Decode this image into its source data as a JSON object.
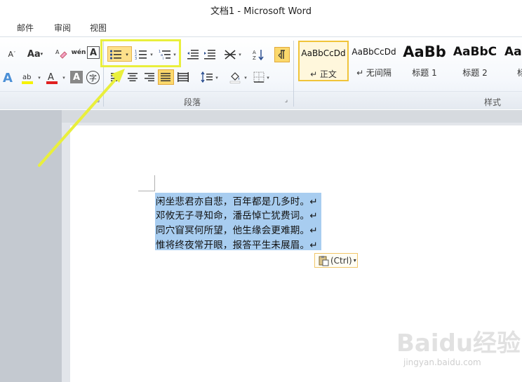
{
  "window": {
    "title": "文档1  -  Microsoft Word"
  },
  "menu": {
    "tabs": [
      "邮件",
      "审阅",
      "视图"
    ]
  },
  "ribbon": {
    "font_size_label": "A",
    "change_case_label": "Aa",
    "phonetic_label": "wén",
    "border_char_label": "A",
    "char_shading_label": "A",
    "enclose_char_label": "字",
    "paragraph_group_label": "段落",
    "styles_group_label": "样式",
    "accent_color": "#e9ef3c",
    "styles": [
      {
        "sample": "AaBbCcDd",
        "name": "↵ 正文"
      },
      {
        "sample": "AaBbCcDd",
        "name": "↵ 无间隔"
      },
      {
        "sample": "AaBb",
        "name": "标题 1"
      },
      {
        "sample": "AaBbC",
        "name": "标题 2"
      },
      {
        "sample": "Aa",
        "name": "标"
      }
    ]
  },
  "document": {
    "lines": [
      "闲坐悲君亦自悲，百年都是几多时。↵",
      "邓攸无子寻知命，潘岳悼亡犹费词。↵",
      "同穴窅冥何所望，他生缘会更难期。↵",
      "惟将终夜常开眼，报答平生未展眉。↵"
    ],
    "paste_options_label": "(Ctrl)"
  },
  "watermark": {
    "brand": "Baidu经验",
    "url": "jingyan.baidu.com"
  }
}
